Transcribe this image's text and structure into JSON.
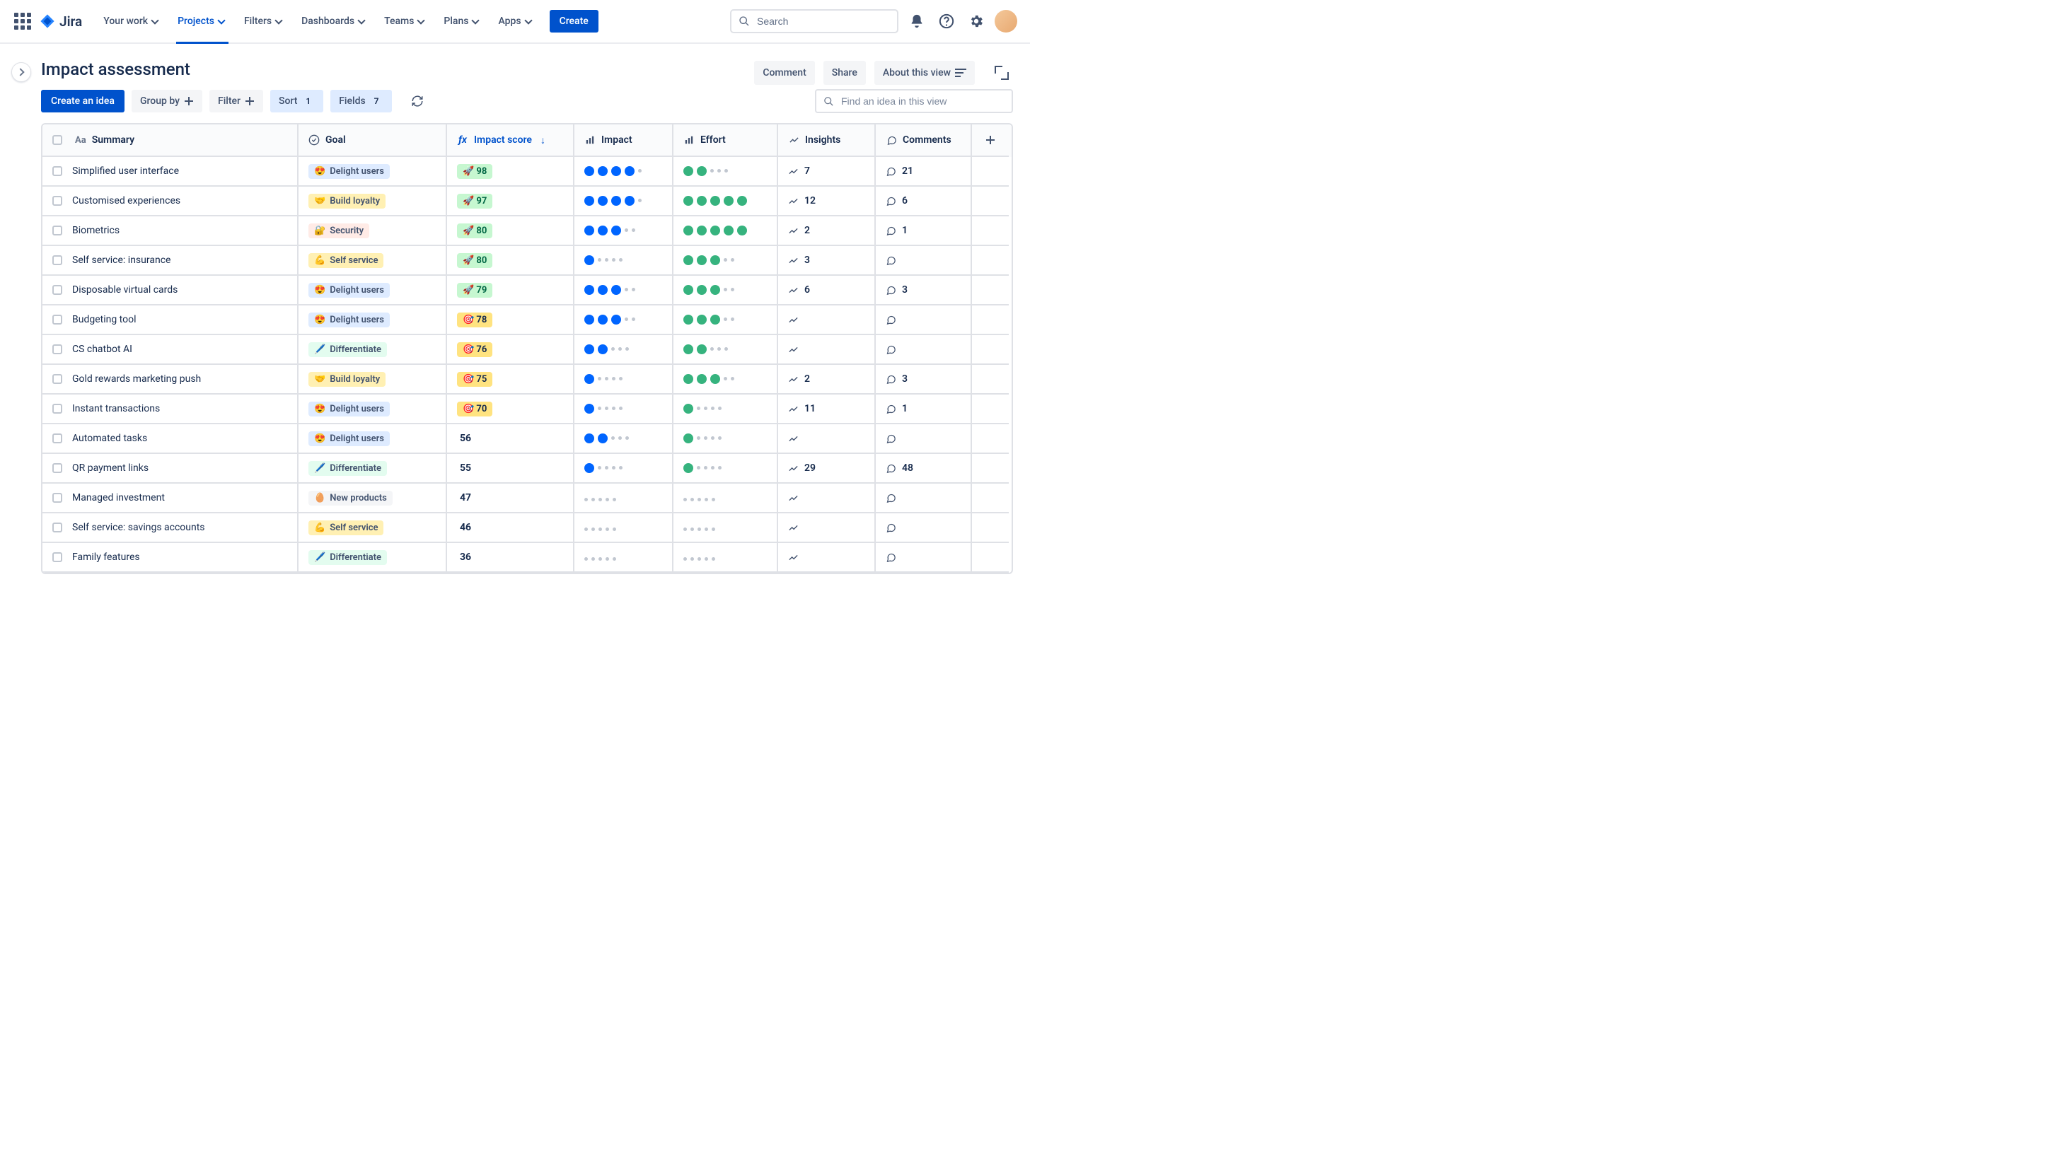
{
  "app": {
    "name": "Jira"
  },
  "nav": {
    "items": [
      "Your work",
      "Projects",
      "Filters",
      "Dashboards",
      "Teams",
      "Plans",
      "Apps"
    ],
    "active_index": 1,
    "create_label": "Create",
    "search_placeholder": "Search"
  },
  "page": {
    "title": "Impact assessment",
    "actions": {
      "comment": "Comment",
      "share": "Share",
      "about": "About this view"
    }
  },
  "toolbar": {
    "create_idea": "Create an idea",
    "group_by": "Group by",
    "filter": "Filter",
    "sort": "Sort",
    "sort_count": "1",
    "fields": "Fields",
    "fields_count": "7",
    "find_placeholder": "Find an idea in this view"
  },
  "columns": {
    "summary": "Summary",
    "goal": "Goal",
    "impact_score": "Impact score",
    "impact": "Impact",
    "effort": "Effort",
    "insights": "Insights",
    "comments": "Comments"
  },
  "goals": {
    "delight": {
      "label": "Delight users",
      "emoji": "😍",
      "class": "g-delight"
    },
    "loyalty": {
      "label": "Build loyalty",
      "emoji": "🤝",
      "class": "g-loyalty"
    },
    "security": {
      "label": "Security",
      "emoji": "🔐",
      "class": "g-security"
    },
    "self": {
      "label": "Self service",
      "emoji": "💪",
      "class": "g-self"
    },
    "diff": {
      "label": "Differentiate",
      "emoji": "🖊️",
      "class": "g-diff"
    },
    "new": {
      "label": "New products",
      "emoji": "🥚",
      "class": "g-new"
    }
  },
  "rows": [
    {
      "summary": "Simplified user interface",
      "goal": "delight",
      "score": "98",
      "score_tier": "green",
      "impact": 4,
      "effort": 2,
      "insights": "7",
      "comments": "21"
    },
    {
      "summary": "Customised experiences",
      "goal": "loyalty",
      "score": "97",
      "score_tier": "green",
      "impact": 4,
      "effort": 5,
      "insights": "12",
      "comments": "6"
    },
    {
      "summary": "Biometrics",
      "goal": "security",
      "score": "80",
      "score_tier": "green",
      "impact": 3,
      "effort": 5,
      "insights": "2",
      "comments": "1"
    },
    {
      "summary": "Self service: insurance",
      "goal": "self",
      "score": "80",
      "score_tier": "green",
      "impact": 1,
      "effort": 3,
      "insights": "3",
      "comments": ""
    },
    {
      "summary": "Disposable virtual cards",
      "goal": "delight",
      "score": "79",
      "score_tier": "green",
      "impact": 3,
      "effort": 3,
      "insights": "6",
      "comments": "3"
    },
    {
      "summary": "Budgeting tool",
      "goal": "delight",
      "score": "78",
      "score_tier": "yellow",
      "impact": 3,
      "effort": 3,
      "insights": "",
      "comments": ""
    },
    {
      "summary": "CS chatbot AI",
      "goal": "diff",
      "score": "76",
      "score_tier": "yellow",
      "impact": 2,
      "effort": 2,
      "insights": "",
      "comments": ""
    },
    {
      "summary": "Gold rewards marketing push",
      "goal": "loyalty",
      "score": "75",
      "score_tier": "yellow",
      "impact": 1,
      "effort": 3,
      "insights": "2",
      "comments": "3"
    },
    {
      "summary": "Instant transactions",
      "goal": "delight",
      "score": "70",
      "score_tier": "yellow",
      "impact": 1,
      "effort": 1,
      "insights": "11",
      "comments": "1"
    },
    {
      "summary": "Automated tasks",
      "goal": "delight",
      "score": "56",
      "score_tier": "plain",
      "impact": 2,
      "effort": 1,
      "insights": "",
      "comments": ""
    },
    {
      "summary": "QR payment links",
      "goal": "diff",
      "score": "55",
      "score_tier": "plain",
      "impact": 1,
      "effort": 1,
      "insights": "29",
      "comments": "48"
    },
    {
      "summary": "Managed investment",
      "goal": "new",
      "score": "47",
      "score_tier": "plain",
      "impact": 0,
      "effort": 0,
      "insights": "",
      "comments": ""
    },
    {
      "summary": "Self service: savings accounts",
      "goal": "self",
      "score": "46",
      "score_tier": "plain",
      "impact": 0,
      "effort": 0,
      "insights": "",
      "comments": ""
    },
    {
      "summary": "Family features",
      "goal": "diff",
      "score": "36",
      "score_tier": "plain",
      "impact": 0,
      "effort": 0,
      "insights": "",
      "comments": ""
    }
  ]
}
